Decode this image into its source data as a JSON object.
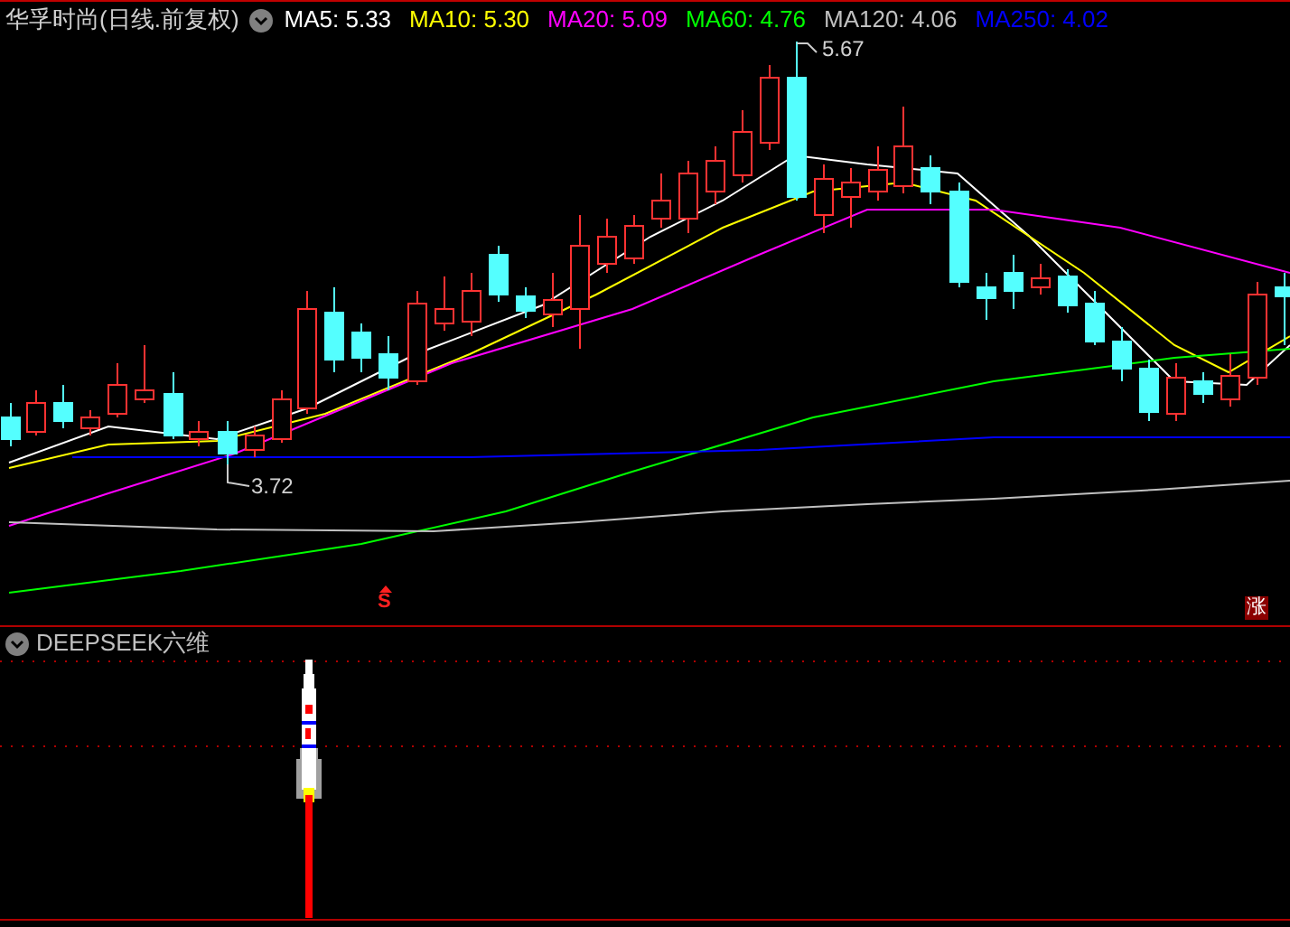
{
  "title": "华孚时尚(日线.前复权)",
  "ma_legend": [
    {
      "label": "MA5:",
      "value": "5.33",
      "color": "#ffffff"
    },
    {
      "label": "MA10:",
      "value": "5.30",
      "color": "#ffff00"
    },
    {
      "label": "MA20:",
      "value": "5.09",
      "color": "#ff00ff"
    },
    {
      "label": "MA60:",
      "value": "4.76",
      "color": "#00ff00"
    },
    {
      "label": "MA120:",
      "value": "4.06",
      "color": "#c0c0c0"
    },
    {
      "label": "MA250:",
      "value": "4.02",
      "color": "#0000ff"
    }
  ],
  "high_label": "5.67",
  "low_label": "3.72",
  "sell_marker": "S",
  "rise_marker": "涨",
  "indicator_title": "DEEPSEEK六维"
}
